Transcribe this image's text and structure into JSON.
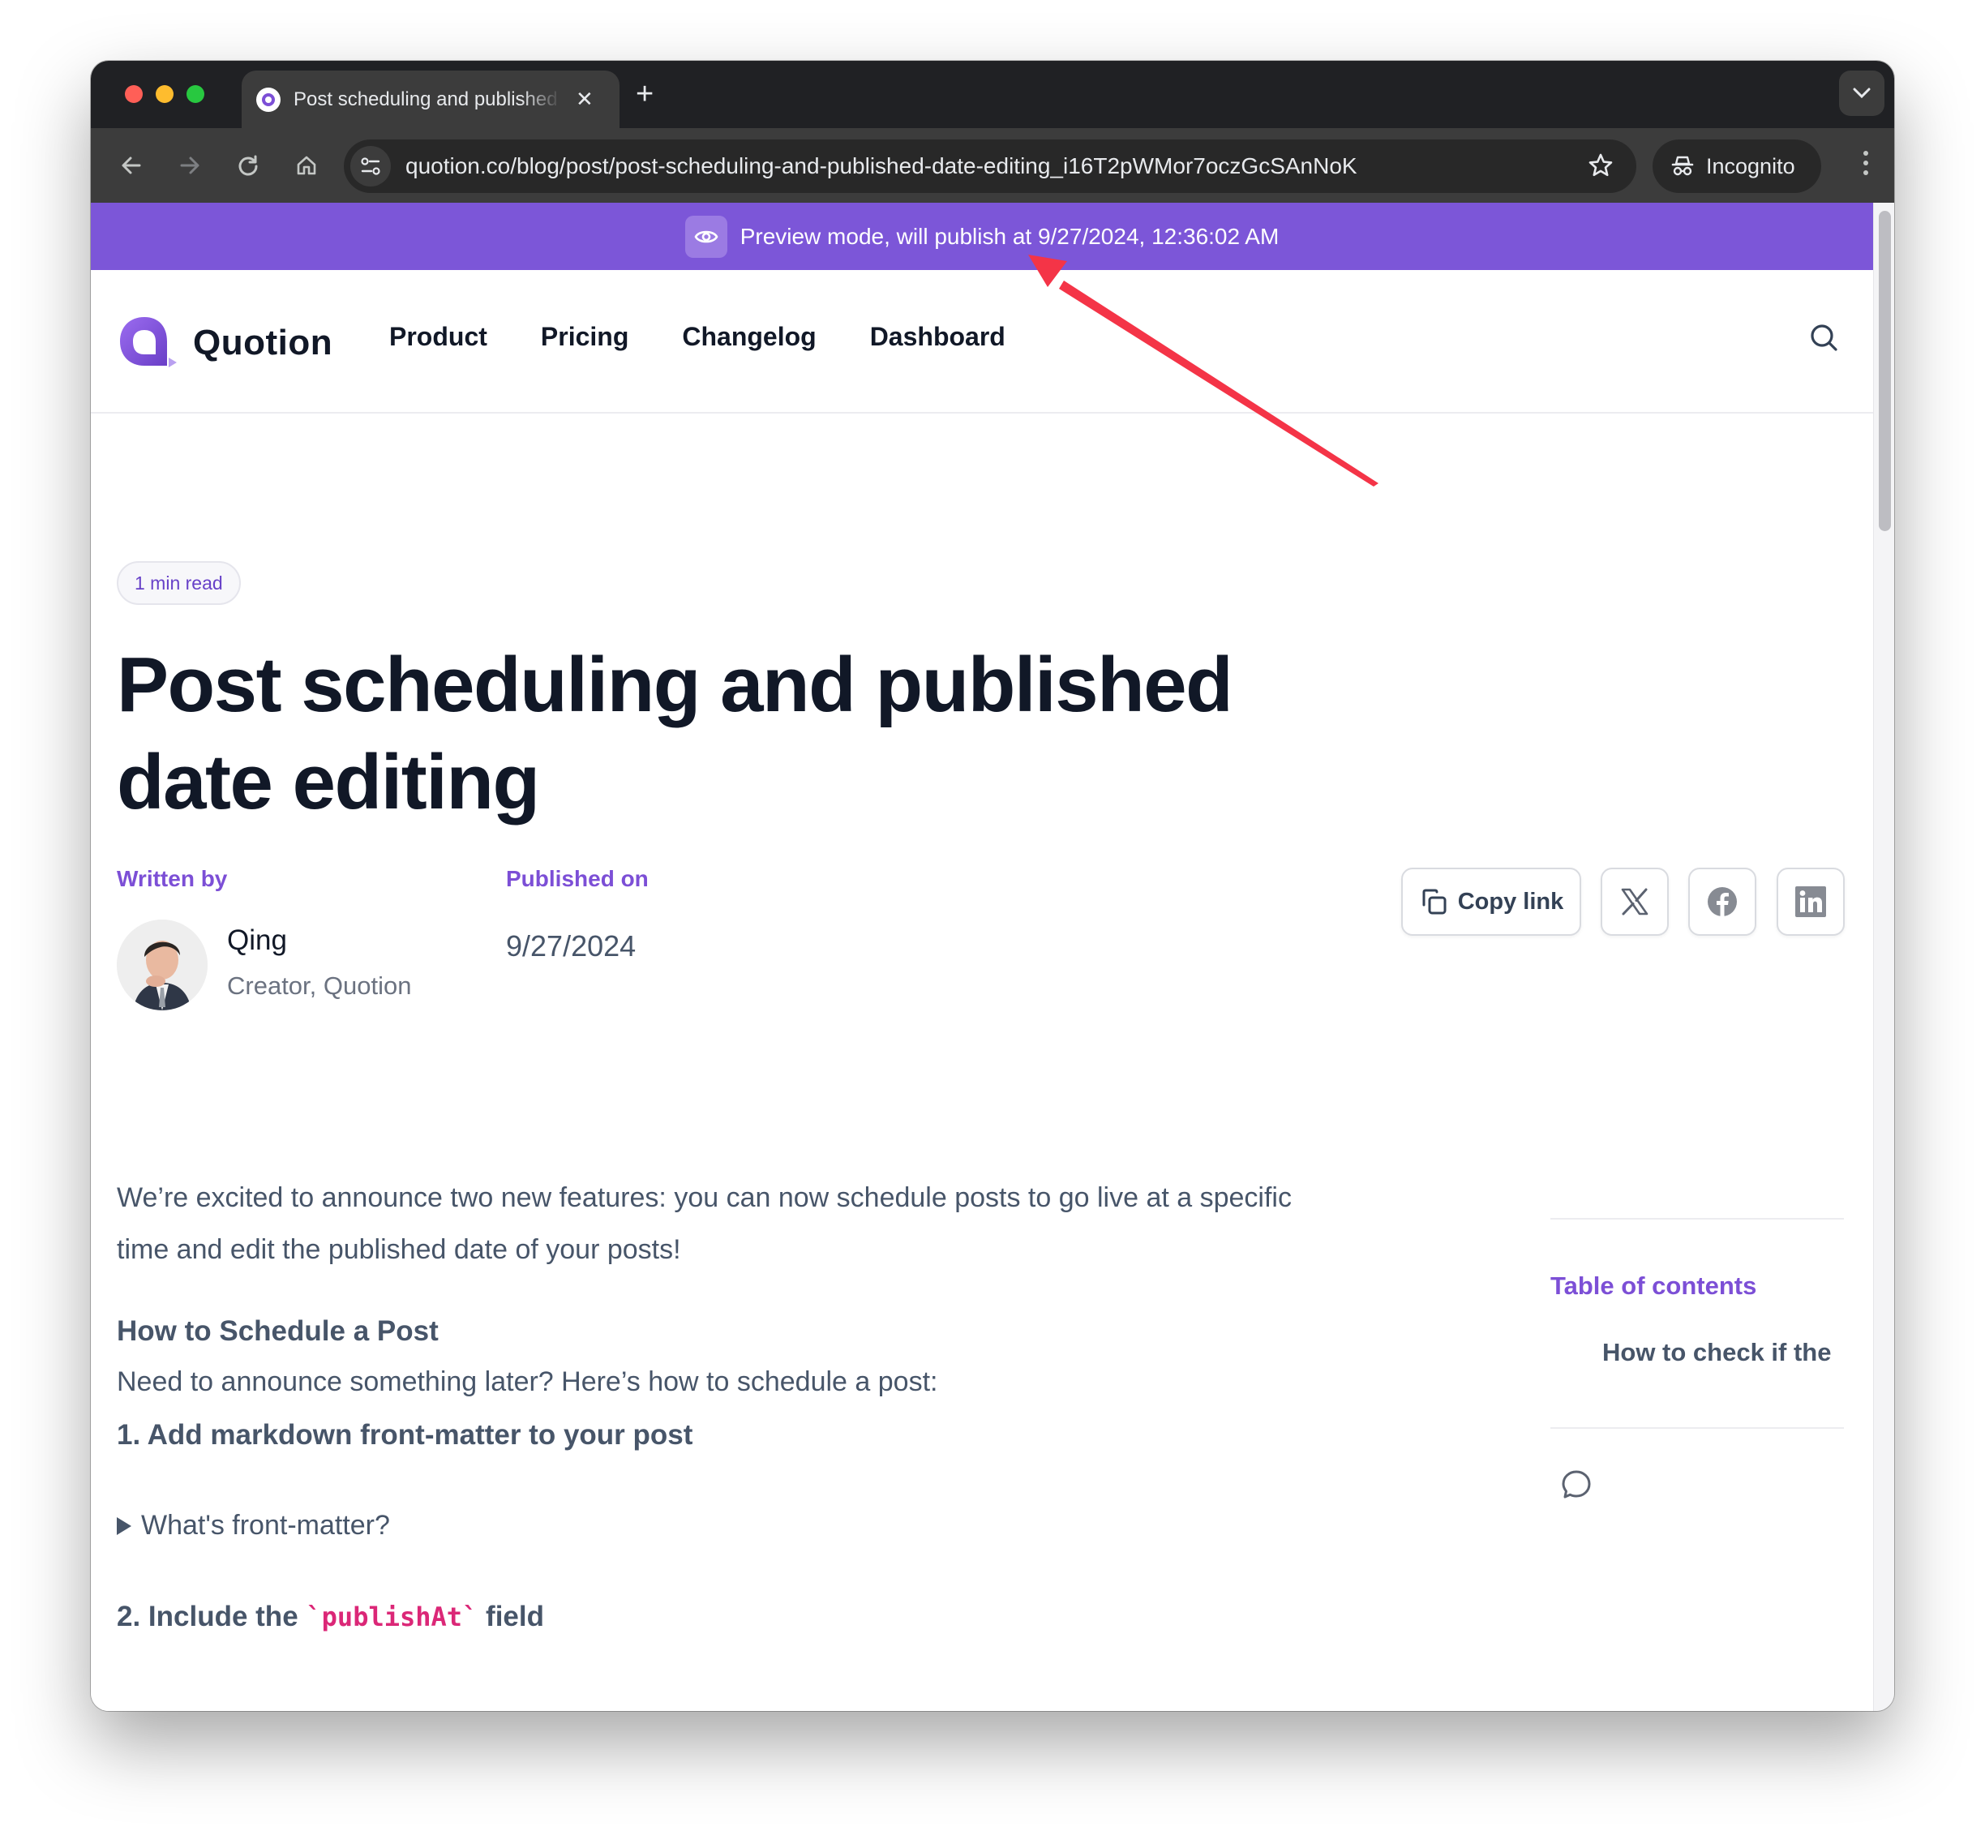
{
  "browser": {
    "tab": {
      "title": "Post scheduling and published date editing",
      "favicon": "quotion-logo-icon"
    },
    "new_tab_label": "+",
    "url": "quotion.co/blog/post/post-scheduling-and-published-date-editing_i16T2pWMor7oczGcSAnNoK",
    "incognito_label": "Incognito",
    "icons": [
      "back-icon",
      "forward-icon",
      "reload-icon",
      "home-icon",
      "site-info-icon",
      "bookmark-star-icon",
      "incognito-icon",
      "more-menu-icon",
      "tab-search-chevron-icon"
    ]
  },
  "banner": {
    "text": "Preview mode, will publish at 9/27/2024, 12:36:02 AM",
    "icon": "eye-icon",
    "color": "#7c56d8"
  },
  "site": {
    "brand": "Quotion",
    "nav": [
      {
        "label": "Product"
      },
      {
        "label": "Pricing"
      },
      {
        "label": "Changelog"
      },
      {
        "label": "Dashboard"
      }
    ],
    "accent_color": "#7c4fd6"
  },
  "article": {
    "read_time": "1 min read",
    "title": "Post scheduling and published date editing",
    "written_by_label": "Written by",
    "author": {
      "name": "Qing",
      "role": "Creator, Quotion"
    },
    "published_on_label": "Published on",
    "published_date": "9/27/2024",
    "share": {
      "copy_link": "Copy link",
      "icons": [
        "x-twitter-icon",
        "facebook-icon",
        "linkedin-icon"
      ]
    },
    "intro": "We’re excited to announce two new features: you can now schedule posts to go live at a specific time and edit the published date of your posts!",
    "section_heading": "How to Schedule a Post",
    "section_intro": "Need to announce something later? Here’s how to schedule a post:",
    "step1": "1. Add markdown front-matter to your post",
    "details_summary": "What's front-matter?",
    "step2_prefix": "2. Include the ",
    "step2_code": "`publishAt`",
    "step2_suffix": " field"
  },
  "toc": {
    "title": "Table of contents",
    "items": [
      {
        "label": "How to check if the"
      }
    ]
  }
}
